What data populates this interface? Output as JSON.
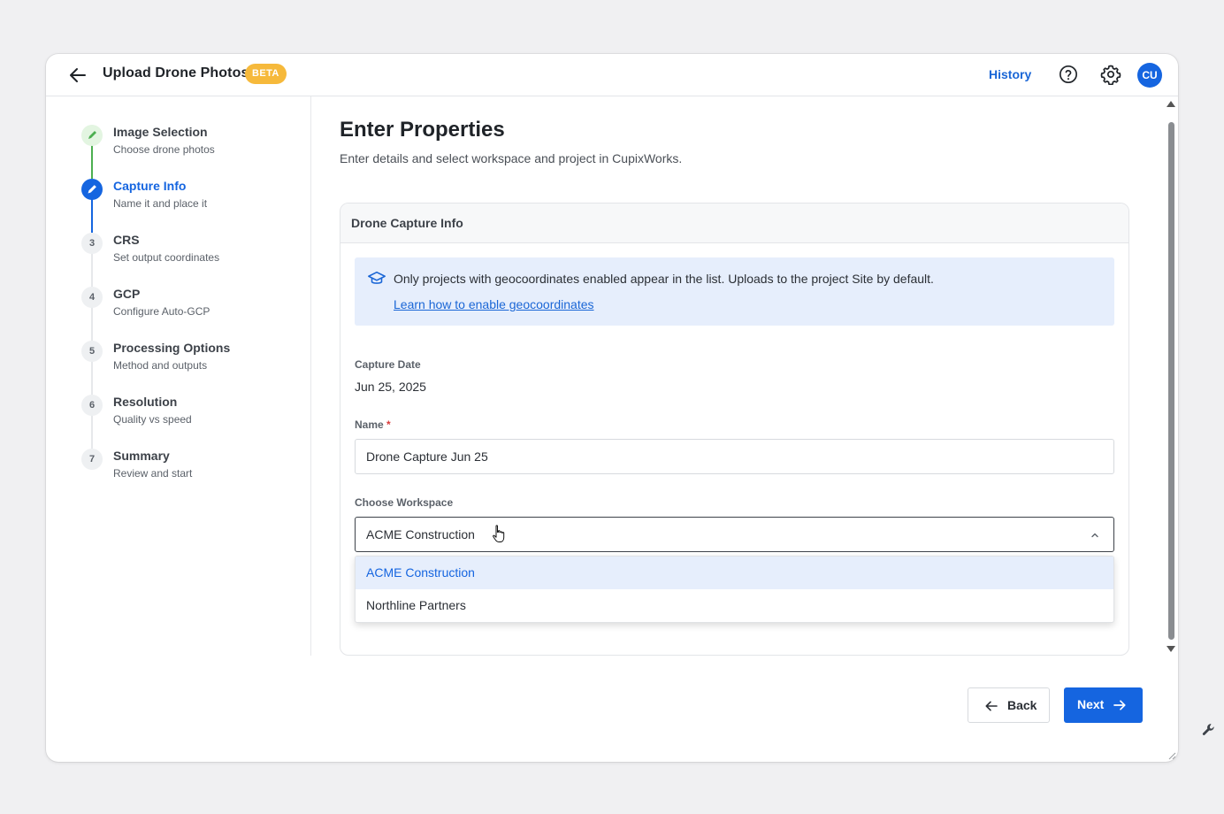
{
  "header": {
    "title": "Upload Drone Photos",
    "badge": "BETA",
    "history_label": "History",
    "avatar_initials": "CU"
  },
  "steps": [
    {
      "number": "1",
      "title": "Image Selection",
      "subtitle": "Choose drone photos",
      "state": "done"
    },
    {
      "number": "2",
      "title": "Capture Info",
      "subtitle": "Name it and place it",
      "state": "active"
    },
    {
      "number": "3",
      "title": "CRS",
      "subtitle": "Set output coordinates",
      "state": "pending"
    },
    {
      "number": "4",
      "title": "GCP",
      "subtitle": "Configure Auto-GCP",
      "state": "pending"
    },
    {
      "number": "5",
      "title": "Processing Options",
      "subtitle": "Method and outputs",
      "state": "pending"
    },
    {
      "number": "6",
      "title": "Resolution",
      "subtitle": "Quality vs speed",
      "state": "pending"
    },
    {
      "number": "7",
      "title": "Summary",
      "subtitle": "Review and start",
      "state": "pending"
    }
  ],
  "main": {
    "title": "Enter Properties",
    "subtitle": "Enter details and select workspace and project in CupixWorks.",
    "panel_title": "Drone Capture Info",
    "info_text": "Only projects with geocoordinates enabled appear in the list. Uploads to the project Site by default.",
    "info_link": "Learn how to enable geocoordinates",
    "capture_date_label": "Capture Date",
    "capture_date_value": "Jun 25, 2025",
    "name_label": "Name",
    "name_required_mark": "*",
    "name_value": "Drone Capture Jun 25",
    "workspace_label": "Choose Workspace",
    "workspace_value": "ACME Construction",
    "workspace_options": [
      "ACME Construction",
      "Northline Partners"
    ],
    "workspace_selected_index": 0
  },
  "footer": {
    "back_label": "Back",
    "next_label": "Next"
  },
  "colors": {
    "accent": "#1565e0",
    "beta_badge": "#f6b93b",
    "info_bg": "#e6eefc",
    "done_step": "#4caf50"
  },
  "icons": {
    "back": "arrow-left-icon",
    "help": "help-circle-icon",
    "settings": "gear-icon",
    "info": "graduation-cap-icon",
    "done_step": "pencil-icon",
    "active_step": "pencil-icon",
    "dropdown": "chevron-up-icon",
    "next": "arrow-right-icon"
  }
}
